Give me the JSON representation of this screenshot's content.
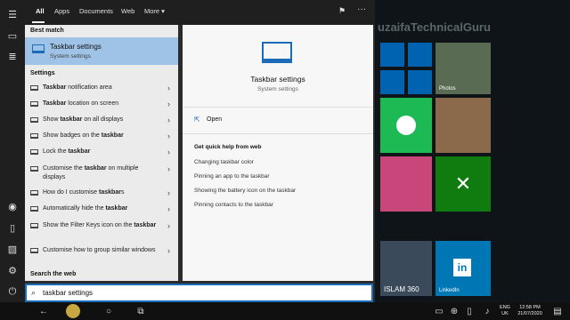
{
  "desktop": {
    "title": "uzaifaTechnicalGuru",
    "tiles": {
      "spotify_color": "#1db954",
      "xbox_color": "#107c10",
      "linkedin_label": "LinkedIn",
      "news_label": "ISLAM 360",
      "photo_label": "Photos"
    }
  },
  "tabs": [
    "All",
    "Apps",
    "Documents",
    "Web",
    "More ▾"
  ],
  "best_match": {
    "label": "Best match",
    "title": "Taskbar settings",
    "subtitle": "System settings"
  },
  "settings": {
    "label": "Settings",
    "items": [
      {
        "pre": "",
        "bold": "Taskbar",
        "post": " notification area"
      },
      {
        "pre": "",
        "bold": "Taskbar",
        "post": " location on screen"
      },
      {
        "pre": "Show ",
        "bold": "taskbar",
        "post": " on all displays"
      },
      {
        "pre": "Show badges on the ",
        "bold": "taskbar",
        "post": ""
      },
      {
        "pre": "Lock the ",
        "bold": "taskbar",
        "post": ""
      },
      {
        "pre": "Customise the ",
        "bold": "taskbar",
        "post": " on multiple displays"
      },
      {
        "pre": "How do I customise ",
        "bold": "taskbar",
        "post": "s"
      },
      {
        "pre": "Automatically hide the ",
        "bold": "taskbar",
        "post": ""
      },
      {
        "pre": "Show the Filter Keys icon on the ",
        "bold": "taskbar",
        "post": ""
      },
      {
        "pre": "Customise how to group similar windows",
        "bold": "",
        "post": ""
      }
    ]
  },
  "search_web_label": "Search the web",
  "preview": {
    "title": "Taskbar settings",
    "subtitle": "System settings",
    "open": "Open",
    "help_heading": "Get quick help from web",
    "links": [
      "Changing taskbar color",
      "Pinning an app to the taskbar",
      "Showing the battery icon on the taskbar",
      "Pinning contacts to the taskbar"
    ]
  },
  "search": {
    "value": "taskbar settings"
  },
  "tray": {
    "lang": "ENG",
    "region": "UK",
    "time": "12:58 PM",
    "date": "21/07/2020"
  },
  "accent": "#1a6bb8"
}
